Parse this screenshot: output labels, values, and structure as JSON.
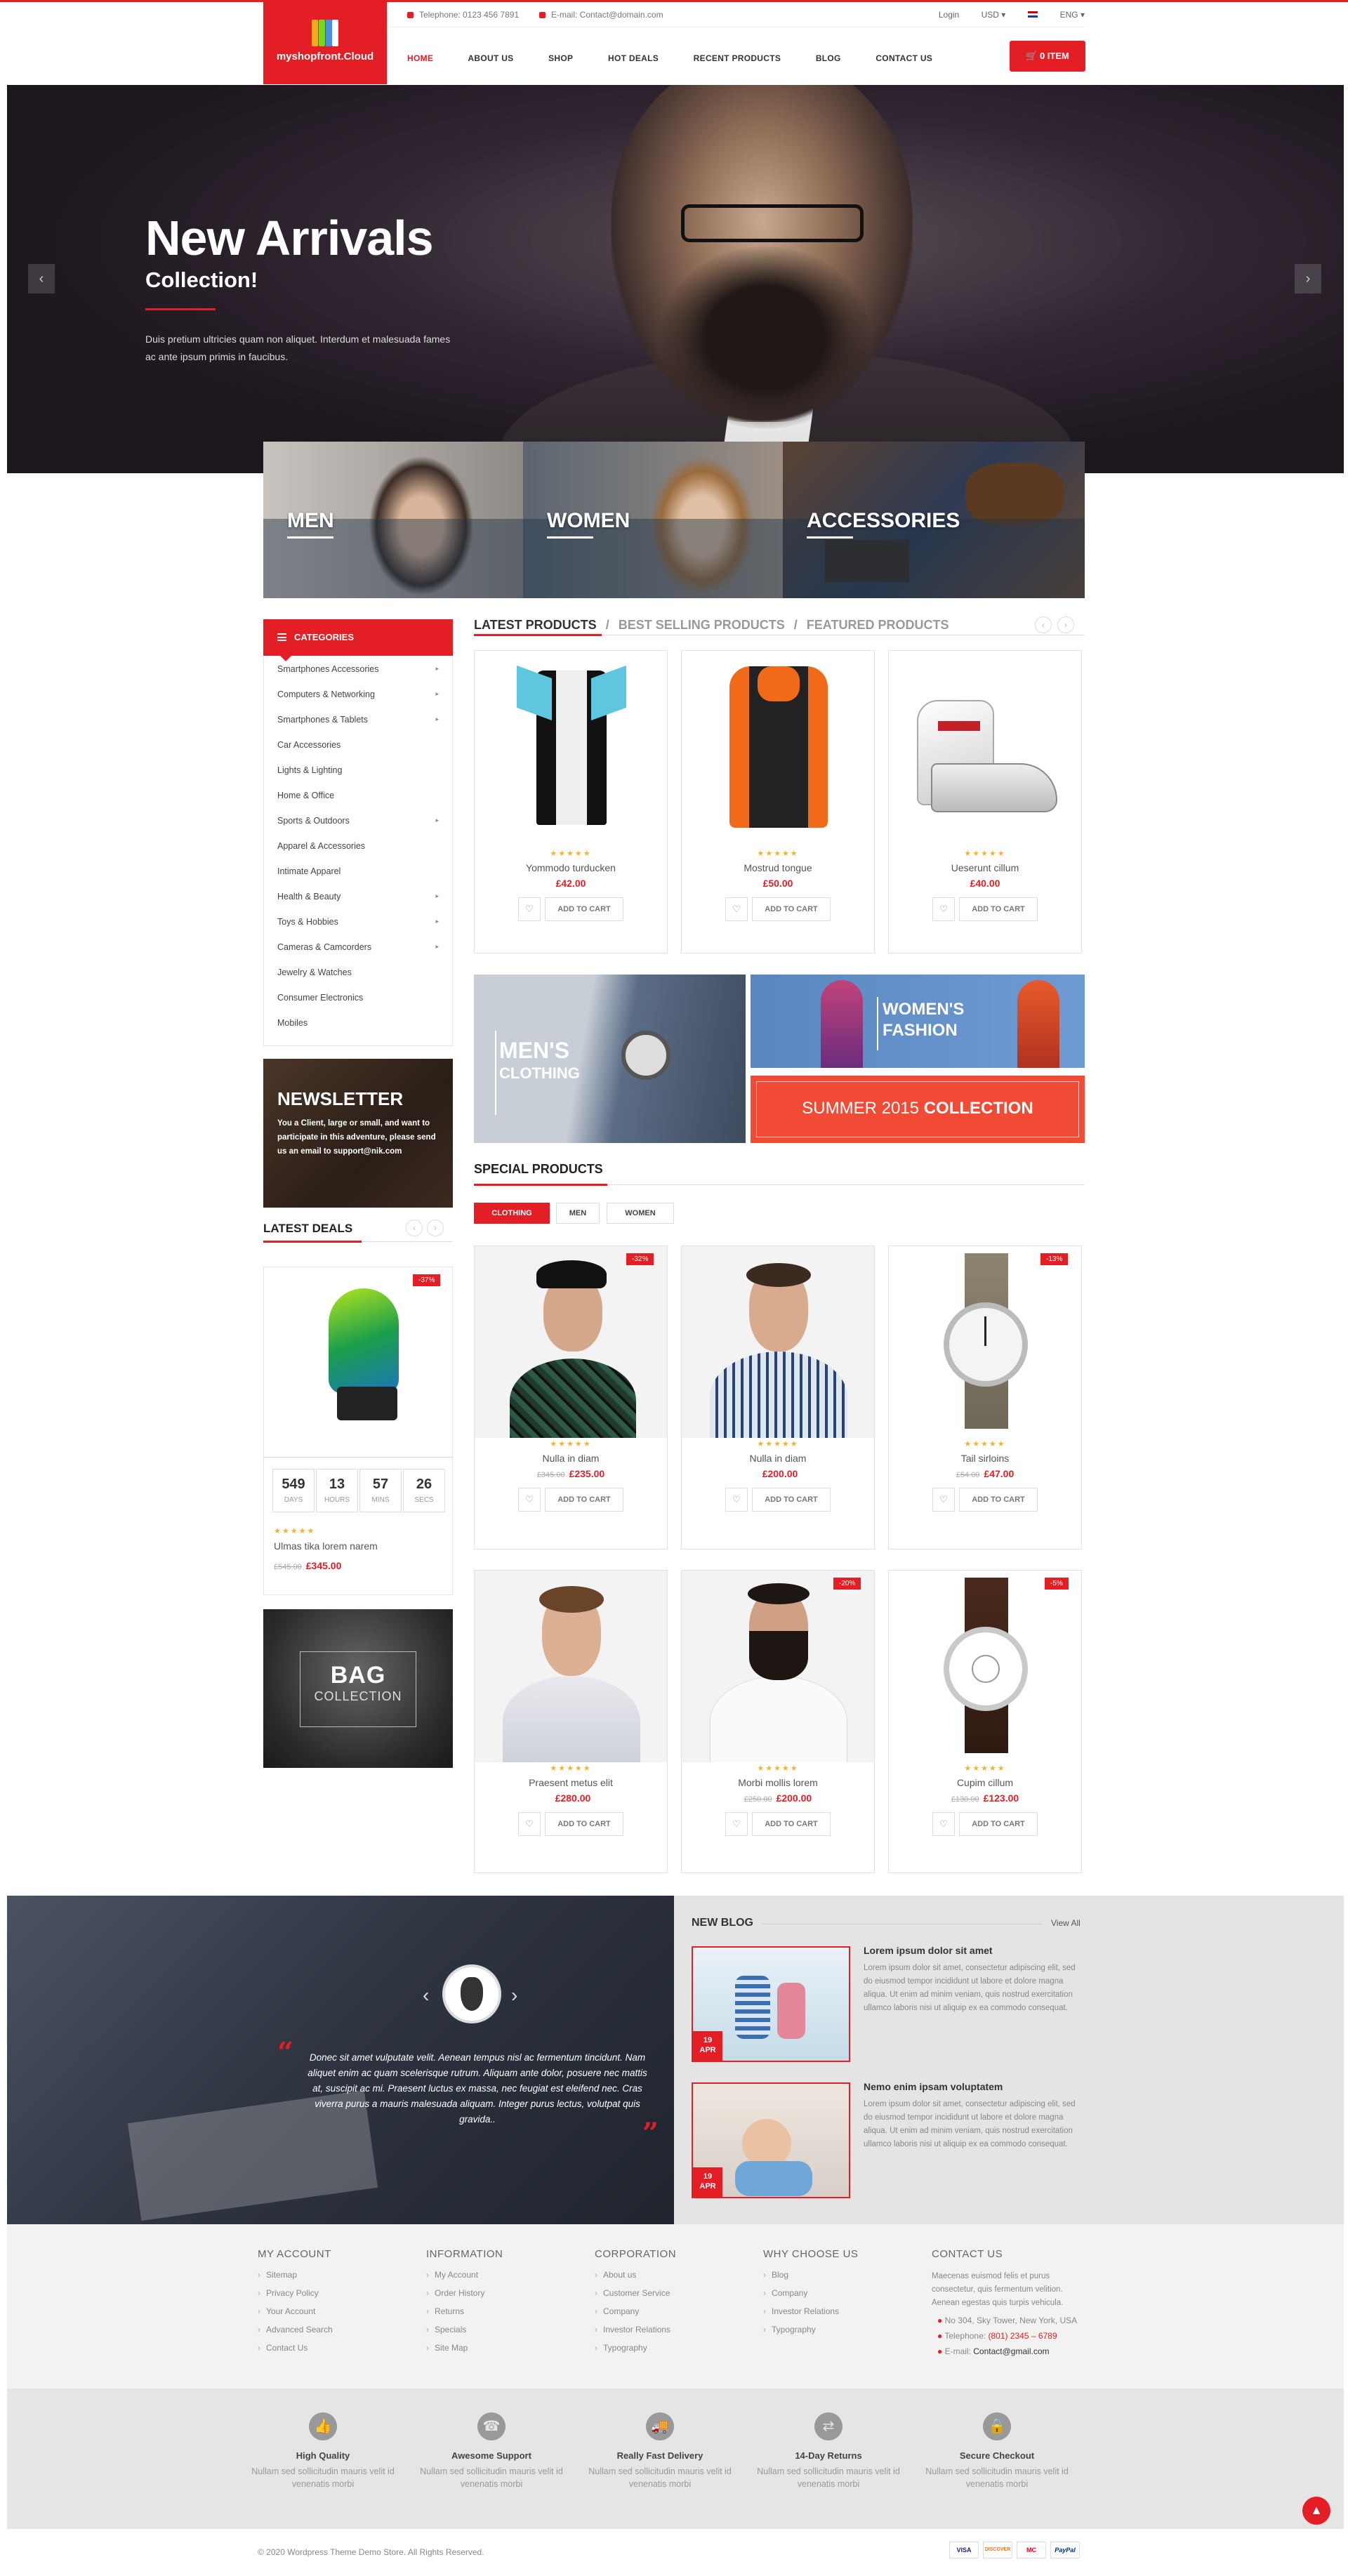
{
  "header": {
    "logo_text": "myshopfront.Cloud",
    "telephone": "Telephone: 0123 456 7891",
    "email": "E-mail: Contact@domain.com",
    "login": "Login",
    "currency": "USD ▾",
    "language": "ENG ▾",
    "cart_label": "0 ITEM",
    "menu": [
      "HOME",
      "ABOUT US",
      "SHOP",
      "HOT DEALS",
      "RECENT PRODUCTS",
      "BLOG",
      "CONTACT US"
    ]
  },
  "hero": {
    "title": "New Arrivals",
    "subtitle": "Collection!",
    "text": "Duis pretium ultricies quam non aliquet. Interdum et malesuada fames ac ante ipsum primis in faucibus.",
    "prev": "‹",
    "next": "›"
  },
  "category_tiles": [
    "MEN",
    "WOMEN",
    "ACCESSORIES"
  ],
  "sidebar": {
    "categories_title": "CATEGORIES",
    "categories": [
      {
        "label": "Smartphones Accessories",
        "chevron": "▸"
      },
      {
        "label": "Computers & Networking",
        "chevron": "▸"
      },
      {
        "label": "Smartphones & Tablets",
        "chevron": "▸"
      },
      {
        "label": "Car Accessories",
        "chevron": ""
      },
      {
        "label": "Lights & Lighting",
        "chevron": ""
      },
      {
        "label": "Home & Office",
        "chevron": ""
      },
      {
        "label": "Sports & Outdoors",
        "chevron": "▸"
      },
      {
        "label": "Apparel & Accessories",
        "chevron": ""
      },
      {
        "label": "Intimate Apparel",
        "chevron": ""
      },
      {
        "label": "Health & Beauty",
        "chevron": "▸"
      },
      {
        "label": "Toys & Hobbies",
        "chevron": "▸"
      },
      {
        "label": "Cameras & Camcorders",
        "chevron": "▸"
      },
      {
        "label": "Jewelry & Watches",
        "chevron": ""
      },
      {
        "label": "Consumer Electronics",
        "chevron": ""
      },
      {
        "label": "Mobiles",
        "chevron": ""
      }
    ],
    "newsletter_title": "NEWSLETTER",
    "newsletter_text": "You a Client, large or small, and want to participate in this adventure, please send us an email to support@nik.com",
    "latest_deals_title": "LATEST DEALS",
    "deal": {
      "badge": "-37%",
      "countdown": [
        {
          "value": "549",
          "unit": "DAYS"
        },
        {
          "value": "13",
          "unit": "HOURS"
        },
        {
          "value": "57",
          "unit": "MINS"
        },
        {
          "value": "26",
          "unit": "SECS"
        }
      ],
      "stars": "★★★★★",
      "name": "Ulmas tika lorem narem",
      "old_price": "£545.00",
      "price": "£345.00"
    },
    "bag_title": "BAG",
    "bag_subtitle": "COLLECTION"
  },
  "product_tabs": [
    "LATEST PRODUCTS",
    "/",
    "BEST SELLING PRODUCTS",
    "/",
    "FEATURED PRODUCTS"
  ],
  "latest_products": [
    {
      "name": "Yommodo turducken",
      "price": "£42.00",
      "stars": "★★★★★",
      "add": "ADD TO CART"
    },
    {
      "name": "Mostrud tongue",
      "price": "£50.00",
      "stars": "★★★★★",
      "add": "ADD TO CART"
    },
    {
      "name": "Ueserunt cillum",
      "price": "£40.00",
      "stars": "★★★★★",
      "add": "ADD TO CART"
    }
  ],
  "banners": {
    "mens_line1": "MEN'S",
    "mens_line2": "CLOTHING",
    "womens_line1": "WOMEN'S",
    "womens_line2": "FASHION",
    "summer_light": "SUMMER 2015 ",
    "summer_bold": "COLLECTION"
  },
  "special": {
    "title": "SPECIAL PRODUCTS",
    "filters": [
      "CLOTHING",
      "MEN",
      "WOMEN"
    ],
    "products": [
      {
        "name": "Nulla in diam",
        "old_price": "£345.00",
        "price": "£235.00",
        "badge": "-32%",
        "stars": "★★★★★",
        "add": "ADD TO CART"
      },
      {
        "name": "Nulla in diam",
        "old_price": "",
        "price": "£200.00",
        "badge": "",
        "stars": "★★★★★",
        "add": "ADD TO CART"
      },
      {
        "name": "Tail sirloins",
        "old_price": "£54.00",
        "price": "£47.00",
        "badge": "-13%",
        "stars": "★★★★★",
        "add": "ADD TO CART"
      },
      {
        "name": "Praesent metus elit",
        "old_price": "",
        "price": "£280.00",
        "badge": "",
        "stars": "★★★★★",
        "add": "ADD TO CART"
      },
      {
        "name": "Morbi mollis lorem",
        "old_price": "£250.00",
        "price": "£200.00",
        "badge": "-20%",
        "stars": "★★★★★",
        "add": "ADD TO CART"
      },
      {
        "name": "Cupim cillum",
        "old_price": "£130.00",
        "price": "£123.00",
        "badge": "-5%",
        "stars": "★★★★★",
        "add": "ADD TO CART"
      }
    ]
  },
  "testimonial": {
    "text": "Donec sit amet vulputate velit. Aenean tempus nisl ac fermentum tincidunt. Nam aliquet enim ac quam scelerisque rutrum. Aliquam ante dolor, posuere nec mattis at, suscipit ac mi. Praesent luctus ex massa, nec feugiat est eleifend nec. Cras viverra purus a mauris malesuada aliquam. Integer purus lectus, volutpat quis gravida..",
    "prev": "‹",
    "next": "›"
  },
  "blog": {
    "title": "NEW BLOG",
    "view_all": "View All",
    "posts": [
      {
        "title": "Lorem ipsum dolor sit amet",
        "day": "19",
        "month": "APR",
        "text": "Lorem ipsum dolor sit amet, consectetur adipiscing elit, sed do eiusmod tempor incididunt ut labore et dolore magna aliqua. Ut enim ad minim veniam, quis nostrud exercitation ullamco laboris nisi ut aliquip ex ea commodo consequat."
      },
      {
        "title": "Nemo enim ipsam voluptatem",
        "day": "19",
        "month": "APR",
        "text": "Lorem ipsum dolor sit amet, consectetur adipiscing elit, sed do eiusmod tempor incididunt ut labore et dolore magna aliqua. Ut enim ad minim veniam, quis nostrud exercitation ullamco laboris nisi ut aliquip ex ea commodo consequat."
      }
    ]
  },
  "footer": {
    "my_account": {
      "title": "MY ACCOUNT",
      "items": [
        "Sitemap",
        "Privacy Policy",
        "Your Account",
        "Advanced Search",
        "Contact Us"
      ]
    },
    "information": {
      "title": "INFORMATION",
      "items": [
        "My Account",
        "Order History",
        "Returns",
        "Specials",
        "Site Map"
      ]
    },
    "corporation": {
      "title": "CORPORATION",
      "items": [
        "About us",
        "Customer Service",
        "Company",
        "Investor Relations",
        "Typography"
      ]
    },
    "why_choose": {
      "title": "WHY CHOOSE US",
      "items": [
        "Blog",
        "Company",
        "Investor Relations",
        "Typography"
      ]
    },
    "contact": {
      "title": "CONTACT US",
      "text": "Maecenas euismod felis et purus consectetur, quis fermentum velition. Aenean egestas quis turpis vehicula.",
      "address": "No 304, Sky Tower, New York, USA",
      "telephone_label": "Telephone: ",
      "telephone": "(801) 2345 – 6789",
      "email_label": "E-mail: ",
      "email": "Contact@gmail.com"
    },
    "features": [
      {
        "title": "High Quality",
        "text": "Nullam sed sollicitudin mauris velit id venenatis morbi",
        "icon": "thumbs-up-icon"
      },
      {
        "title": "Awesome Support",
        "text": "Nullam sed sollicitudin mauris velit id venenatis morbi",
        "icon": "support-icon"
      },
      {
        "title": "Really Fast Delivery",
        "text": "Nullam sed sollicitudin mauris velit id venenatis morbi",
        "icon": "truck-icon"
      },
      {
        "title": "14-Day Returns",
        "text": "Nullam sed sollicitudin mauris velit id venenatis morbi",
        "icon": "returns-icon"
      },
      {
        "title": "Secure Checkout",
        "text": "Nullam sed sollicitudin mauris velit id venenatis morbi",
        "icon": "lock-icon"
      }
    ],
    "copyright": "© 2020 Wordpress Theme Demo Store. All Rights Reserved.",
    "payments": [
      "VISA",
      "DISCOVER",
      "MC",
      "PayPal"
    ]
  },
  "colors": {
    "accent": "#e31e24"
  }
}
